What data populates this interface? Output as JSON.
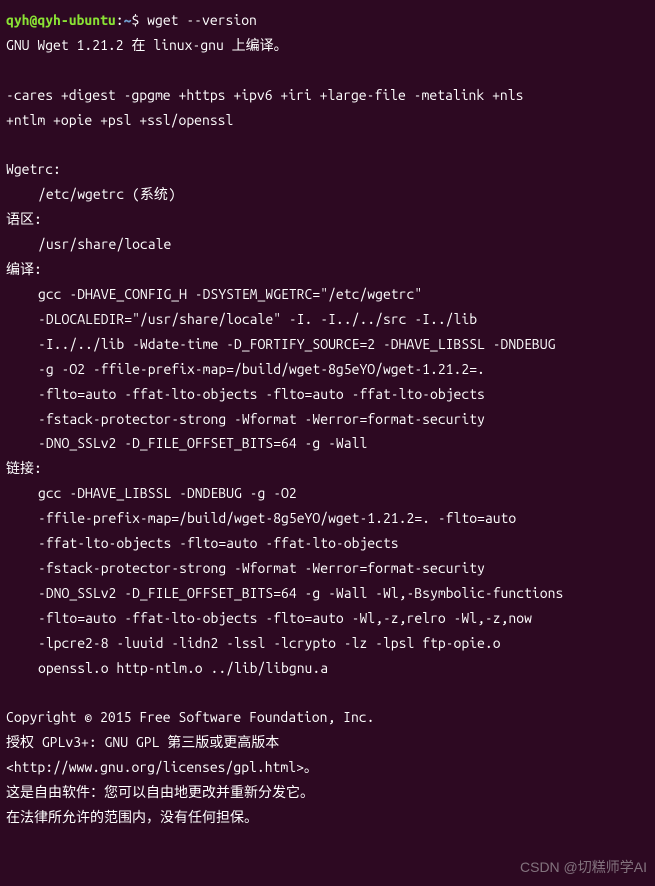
{
  "prompt": {
    "user_host": "qyh@qyh-ubuntu",
    "colon": ":",
    "path": "~",
    "dollar": "$ ",
    "command": "wget --version"
  },
  "output": {
    "line1": "GNU Wget 1.21.2 在 linux-gnu 上编译。",
    "features1": "-cares +digest -gpgme +https +ipv6 +iri +large-file -metalink +nls ",
    "features2": "+ntlm +opie +psl +ssl/openssl ",
    "wgetrc_header": "Wgetrc: ",
    "wgetrc_path": "/etc/wgetrc (系统)",
    "locale_header": "语区: ",
    "locale_path": "/usr/share/locale ",
    "compile_header": "编译: ",
    "compile1": "gcc -DHAVE_CONFIG_H -DSYSTEM_WGETRC=\"/etc/wgetrc\" ",
    "compile2": "-DLOCALEDIR=\"/usr/share/locale\" -I. -I../../src -I../lib ",
    "compile3": "-I../../lib -Wdate-time -D_FORTIFY_SOURCE=2 -DHAVE_LIBSSL -DNDEBUG ",
    "compile4": "-g -O2 -ffile-prefix-map=/build/wget-8g5eYO/wget-1.21.2=. ",
    "compile5": "-flto=auto -ffat-lto-objects -flto=auto -ffat-lto-objects ",
    "compile6": "-fstack-protector-strong -Wformat -Werror=format-security ",
    "compile7": "-DNO_SSLv2 -D_FILE_OFFSET_BITS=64 -g -Wall ",
    "link_header": "链接: ",
    "link1": "gcc -DHAVE_LIBSSL -DNDEBUG -g -O2 ",
    "link2": "-ffile-prefix-map=/build/wget-8g5eYO/wget-1.21.2=. -flto=auto ",
    "link3": "-ffat-lto-objects -flto=auto -ffat-lto-objects ",
    "link4": "-fstack-protector-strong -Wformat -Werror=format-security ",
    "link5": "-DNO_SSLv2 -D_FILE_OFFSET_BITS=64 -g -Wall -Wl,-Bsymbolic-functions ",
    "link6": "-flto=auto -ffat-lto-objects -flto=auto -Wl,-z,relro -Wl,-z,now ",
    "link7": "-lpcre2-8 -luuid -lidn2 -lssl -lcrypto -lz -lpsl ftp-opie.o ",
    "link8": "openssl.o http-ntlm.o ../lib/libgnu.a ",
    "copyright": "Copyright © 2015 Free Software Foundation, Inc.",
    "license": "授权 GPLv3+: GNU GPL 第三版或更高版本",
    "license_url": "<http://www.gnu.org/licenses/gpl.html>。",
    "free1": "这是自由软件：您可以自由地更改并重新分发它。",
    "free2": "在法律所允许的范围内，没有任何担保。"
  },
  "watermark": "CSDN @切糕师学AI"
}
